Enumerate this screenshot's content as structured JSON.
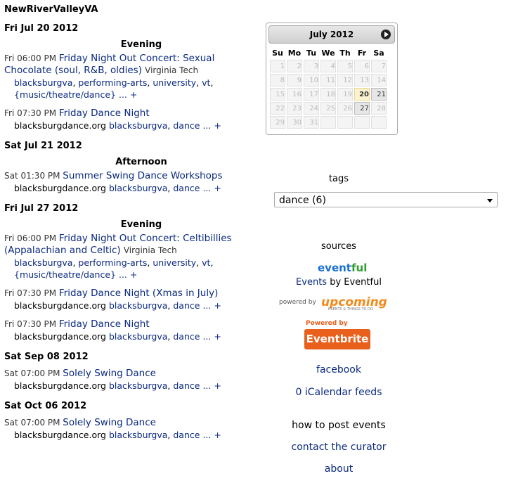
{
  "site": {
    "title": "NewRiverValleyVA"
  },
  "days": [
    {
      "date": "Fri Jul 20 2012",
      "groups": [
        {
          "period": "Evening",
          "events": [
            {
              "time": "Fri 06:00 PM",
              "title": "Friday Night Out Concert: Sexual Chocolate (soul, R&B, oldies)",
              "venue": "Virginia Tech",
              "line2": [
                "blacksburgva",
                "performing-arts",
                "university",
                "vt",
                "{music/theatre/dance}"
              ],
              "source": ""
            },
            {
              "time": "Fri 07:30 PM",
              "title": "Friday Dance Night",
              "venue": "",
              "line2": [
                "blacksburgva",
                "dance"
              ],
              "source": "blacksburgdance.org"
            }
          ]
        }
      ]
    },
    {
      "date": "Sat Jul 21 2012",
      "groups": [
        {
          "period": "Afternoon",
          "events": [
            {
              "time": "Sat 01:30 PM",
              "title": "Summer Swing Dance Workshops",
              "venue": "",
              "line2": [
                "blacksburgva",
                "dance"
              ],
              "source": "blacksburgdance.org"
            }
          ]
        }
      ]
    },
    {
      "date": "Fri Jul 27 2012",
      "groups": [
        {
          "period": "Evening",
          "events": [
            {
              "time": "Fri 06:00 PM",
              "title": "Friday Night Out Concert: Celtibillies (Appalachian and Celtic)",
              "venue": "Virginia Tech",
              "line2": [
                "blacksburgva",
                "performing-arts",
                "university",
                "vt",
                "{music/theatre/dance}"
              ],
              "source": ""
            },
            {
              "time": "Fri 07:30 PM",
              "title": "Friday Dance Night (Xmas in July)",
              "venue": "",
              "line2": [
                "blacksburgva",
                "dance"
              ],
              "source": "blacksburgdance.org"
            },
            {
              "time": "Fri 07:30 PM",
              "title": "Friday Dance Night",
              "venue": "",
              "line2": [
                "blacksburgva",
                "dance"
              ],
              "source": "blacksburgdance.org"
            }
          ]
        }
      ]
    },
    {
      "date": "Sat Sep 08 2012",
      "groups": [
        {
          "period": "",
          "events": [
            {
              "time": "Sat 07:00 PM",
              "title": "Solely Swing Dance",
              "venue": "",
              "line2": [
                "blacksburgva",
                "dance"
              ],
              "source": "blacksburgdance.org"
            }
          ]
        }
      ]
    },
    {
      "date": "Sat Oct 06 2012",
      "groups": [
        {
          "period": "",
          "events": [
            {
              "time": "Sat 07:00 PM",
              "title": "Solely Swing Dance",
              "venue": "",
              "line2": [
                "blacksburgva",
                "dance"
              ],
              "source": "blacksburgdance.org"
            }
          ]
        }
      ]
    }
  ],
  "more_label": "... +",
  "calendar": {
    "month_label": "July 2012",
    "weekdays": [
      "Su",
      "Mo",
      "Tu",
      "We",
      "Th",
      "Fr",
      "Sa"
    ],
    "weeks": [
      [
        "1",
        "2",
        "3",
        "4",
        "5",
        "6",
        "7"
      ],
      [
        "8",
        "9",
        "10",
        "11",
        "12",
        "13",
        "14"
      ],
      [
        "15",
        "16",
        "17",
        "18",
        "19",
        "20",
        "21"
      ],
      [
        "22",
        "23",
        "24",
        "25",
        "26",
        "27",
        "28"
      ],
      [
        "29",
        "30",
        "31",
        "",
        "",
        "",
        ""
      ]
    ],
    "today": "20",
    "highlighted": [
      "21",
      "27"
    ]
  },
  "sidebar": {
    "tags_label": "tags",
    "tag_select_value": "dance (6)",
    "sources_label": "sources",
    "eventful_logo_a": "event",
    "eventful_logo_b": "ful",
    "eventful_link_a": "Events",
    "eventful_link_b": " by Eventful",
    "upcoming_powered": "powered by",
    "upcoming_logo": "upcoming",
    "upcoming_tagline": "EVENTS & THINGS TO DO",
    "eventbrite_powered": "Powered by",
    "eventbrite_logo": "Eventbrite",
    "facebook": "facebook",
    "ical": "0 iCalendar feeds",
    "how_to_post": "how to post events",
    "contact": "contact the curator",
    "about": "about"
  }
}
